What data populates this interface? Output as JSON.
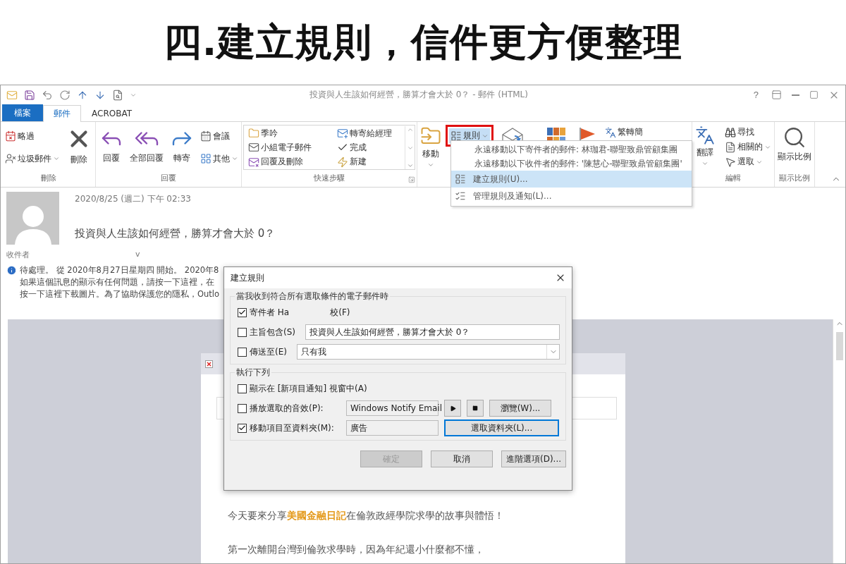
{
  "heading": "四.建立規則，信件更方便整理",
  "window": {
    "title": "投資與人生該如何經營，勝算才會大於 0？ - 郵件 (HTML)",
    "help": "?"
  },
  "tabs": [
    {
      "label": "檔案",
      "kind": "file",
      "selected": false
    },
    {
      "label": "郵件",
      "kind": "tab",
      "selected": true
    },
    {
      "label": "ACROBAT",
      "kind": "tab",
      "selected": false
    }
  ],
  "ribbon": [
    {
      "label": "刪除",
      "kind": "plain",
      "items": [
        {
          "kind": "small",
          "label": "略過",
          "dropdown": false
        },
        {
          "kind": "small",
          "label": "垃圾郵件",
          "dropdown": true
        },
        {
          "kind": "large",
          "label": "刪除",
          "dropdown": false
        }
      ]
    },
    {
      "label": "回覆",
      "kind": "plain",
      "items": [
        {
          "kind": "large",
          "label": "回覆",
          "dropdown": false
        },
        {
          "kind": "large",
          "label": "全部回覆",
          "dropdown": false
        },
        {
          "kind": "large",
          "label": "轉寄",
          "dropdown": false
        },
        {
          "kind": "small",
          "label": "會議",
          "dropdown": false
        },
        {
          "kind": "small",
          "label": "其他",
          "dropdown": true
        }
      ]
    },
    {
      "label": "快速步驟",
      "kind": "gallery",
      "items": [
        {
          "kind": "small",
          "label": "季吟",
          "dropdown": false
        },
        {
          "kind": "small",
          "label": "小組電子郵件",
          "dropdown": false
        },
        {
          "kind": "small",
          "label": "回覆及刪除",
          "dropdown": false
        },
        {
          "kind": "small",
          "label": "轉寄給經理",
          "dropdown": false
        },
        {
          "kind": "small",
          "label": "完成",
          "dropdown": false
        },
        {
          "kind": "small",
          "label": "新建",
          "dropdown": false
        }
      ]
    },
    {
      "kind": "plain",
      "items": [
        {
          "kind": "large",
          "label": "移動",
          "dropdown": true
        },
        {
          "kind": "small",
          "label": "規則",
          "dropdown": true,
          "highlighted": true,
          "open": true
        },
        {
          "kind": "icon"
        },
        {
          "kind": "icon"
        },
        {
          "kind": "icon"
        },
        {
          "kind": "small",
          "label": "繁轉簡",
          "dropdown": false
        }
      ]
    },
    {
      "label": "編輯",
      "kind": "plain",
      "items": [
        {
          "kind": "large",
          "label": "翻譯",
          "dropdown": true
        },
        {
          "kind": "small",
          "label": "尋找",
          "dropdown": false
        },
        {
          "kind": "small",
          "label": "相關的",
          "dropdown": true
        },
        {
          "kind": "small",
          "label": "選取",
          "dropdown": true
        }
      ]
    },
    {
      "label": "顯示比例",
      "kind": "plain",
      "items": [
        {
          "kind": "large",
          "label": "顯示比例",
          "dropdown": false
        }
      ]
    }
  ],
  "rules_menu": [
    {
      "label": "永遠移動以下寄件者的郵件: 林珈君-聯聖致鼎管顧集團",
      "kind": "text",
      "selected": false
    },
    {
      "label": "永遠移動以下收件者的郵件: '陳慧心-聯聖致鼎管顧集團'",
      "kind": "text",
      "selected": false
    },
    {
      "label": "建立規則(U)...",
      "kind": "create",
      "selected": true
    },
    {
      "label": "管理規則及通知(L)...",
      "kind": "manage",
      "selected": false
    }
  ],
  "message": {
    "date": "2020/8/25 (週二) 下午 02:33",
    "subject": "投資與人生該如何經營，勝算才會大於 0？",
    "to_label": "收件者",
    "to_value": "v",
    "info": [
      "待處理。 從 2020年8月27日星期四 開始。 2020年8",
      "如果這個訊息的顯示有任何問題，請按一下這裡，在",
      "按一下這裡下載圖片。為了協助保護您的隱私，Outlo"
    ],
    "body": [
      "今天要來分享**美國金融日記**在倫敦政經學院求學的故事與體悟！",
      "第一次離開台灣到倫敦求學時，因為年紀還小什麼都不懂，"
    ]
  },
  "dialog": {
    "title": "建立規則",
    "conditions_label": "當我收到符合所有選取條件的電子郵件時",
    "conditions": [
      {
        "kind": "sender",
        "label": "寄件者 Ha",
        "extra": "校(F)",
        "checked": true
      },
      {
        "kind": "text",
        "label": "主旨包含(S)",
        "value": "投資與人生該如何經營，勝算才會大於 0？",
        "checked": false
      },
      {
        "kind": "select",
        "label": "傳送至(E)",
        "value": "只有我",
        "checked": false
      }
    ],
    "actions_label": "執行下列",
    "actions": [
      {
        "kind": "plain",
        "label": "顯示在 [新項目通知] 視窗中(A)",
        "checked": false
      },
      {
        "kind": "sound",
        "label": "播放選取的音效(P):",
        "value": "Windows Notify Email",
        "button": "瀏覽(W)...",
        "checked": false
      },
      {
        "kind": "folder",
        "label": "移動項目至資料夾(M):",
        "value": "廣告",
        "button": "選取資料夾(L)...",
        "checked": true
      }
    ],
    "buttons": [
      {
        "label": "確定",
        "disabled": true
      },
      {
        "label": "取消",
        "disabled": false
      },
      {
        "label": "進階選項(D)...",
        "disabled": false
      }
    ]
  }
}
